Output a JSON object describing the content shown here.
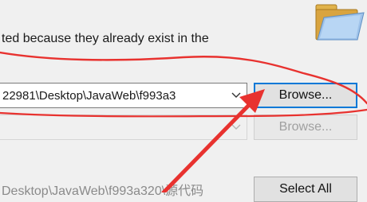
{
  "message": "ted because they already exist in the",
  "icons": {
    "folder": "folder-icon",
    "dropdown": "chevron-down-icon"
  },
  "combo1": {
    "value": "22981\\Desktop\\JavaWeb\\f993a3"
  },
  "buttons": {
    "browse1": "Browse...",
    "browse2": "Browse...",
    "select_all": "Select All"
  },
  "path_bottom": "Desktop\\JavaWeb\\f993a320\\源代码",
  "annotation": {
    "color": "#e8322f"
  }
}
